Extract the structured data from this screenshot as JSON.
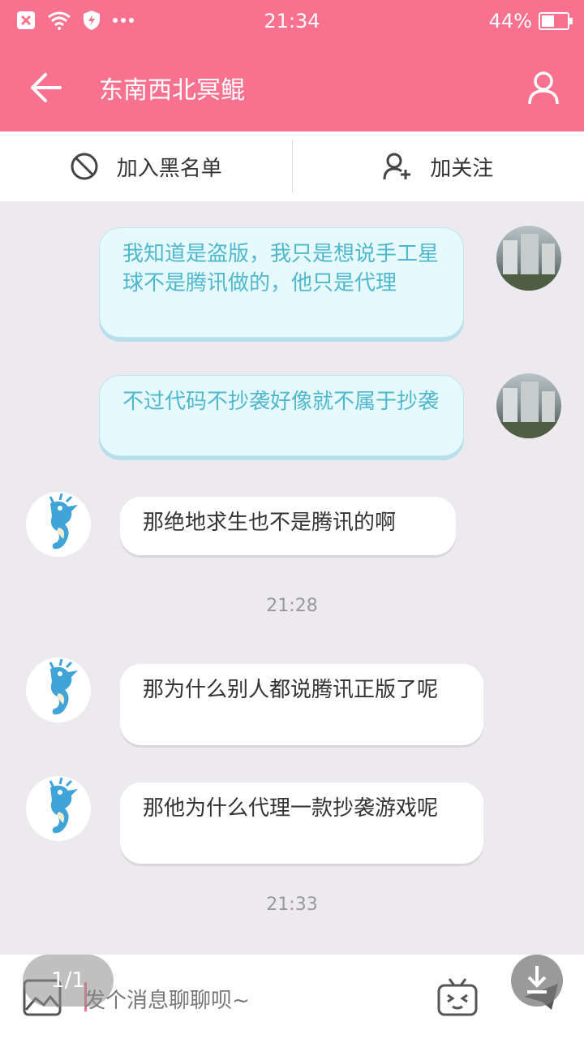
{
  "status": {
    "time": "21:34",
    "battery": "44%",
    "battery_level": 0.44,
    "icons": [
      "notification-x-icon",
      "wifi-icon",
      "shield-icon",
      "more-dots-icon"
    ]
  },
  "header": {
    "title": "东南西北冥鲲",
    "back_icon": "arrow-left-icon",
    "user_icon": "user-icon"
  },
  "actions": {
    "blacklist_label": "加入黑名单",
    "follow_label": "加关注"
  },
  "messages": [
    {
      "from": "me",
      "text": "我知道是盗版，我只是想说手工星球不是腾讯做的，他只是代理"
    },
    {
      "from": "me",
      "text": "不过代码不抄袭好像就不属于抄袭"
    },
    {
      "from": "other",
      "text": "那绝地求生也不是腾讯的啊"
    },
    {
      "type": "time",
      "text": "21:28"
    },
    {
      "from": "other",
      "text": "那为什么别人都说腾讯正版了呢"
    },
    {
      "from": "other",
      "text": "那他为什么代理一款抄袭游戏呢"
    },
    {
      "type": "time",
      "text": "21:33"
    }
  ],
  "input": {
    "placeholder": "发个消息聊聊呗~",
    "pager": "1/1"
  },
  "colors": {
    "brand": "#f8728f",
    "my_bubble": "#e6f9fd",
    "my_text": "#4fb8cc",
    "background": "#eceaee"
  }
}
